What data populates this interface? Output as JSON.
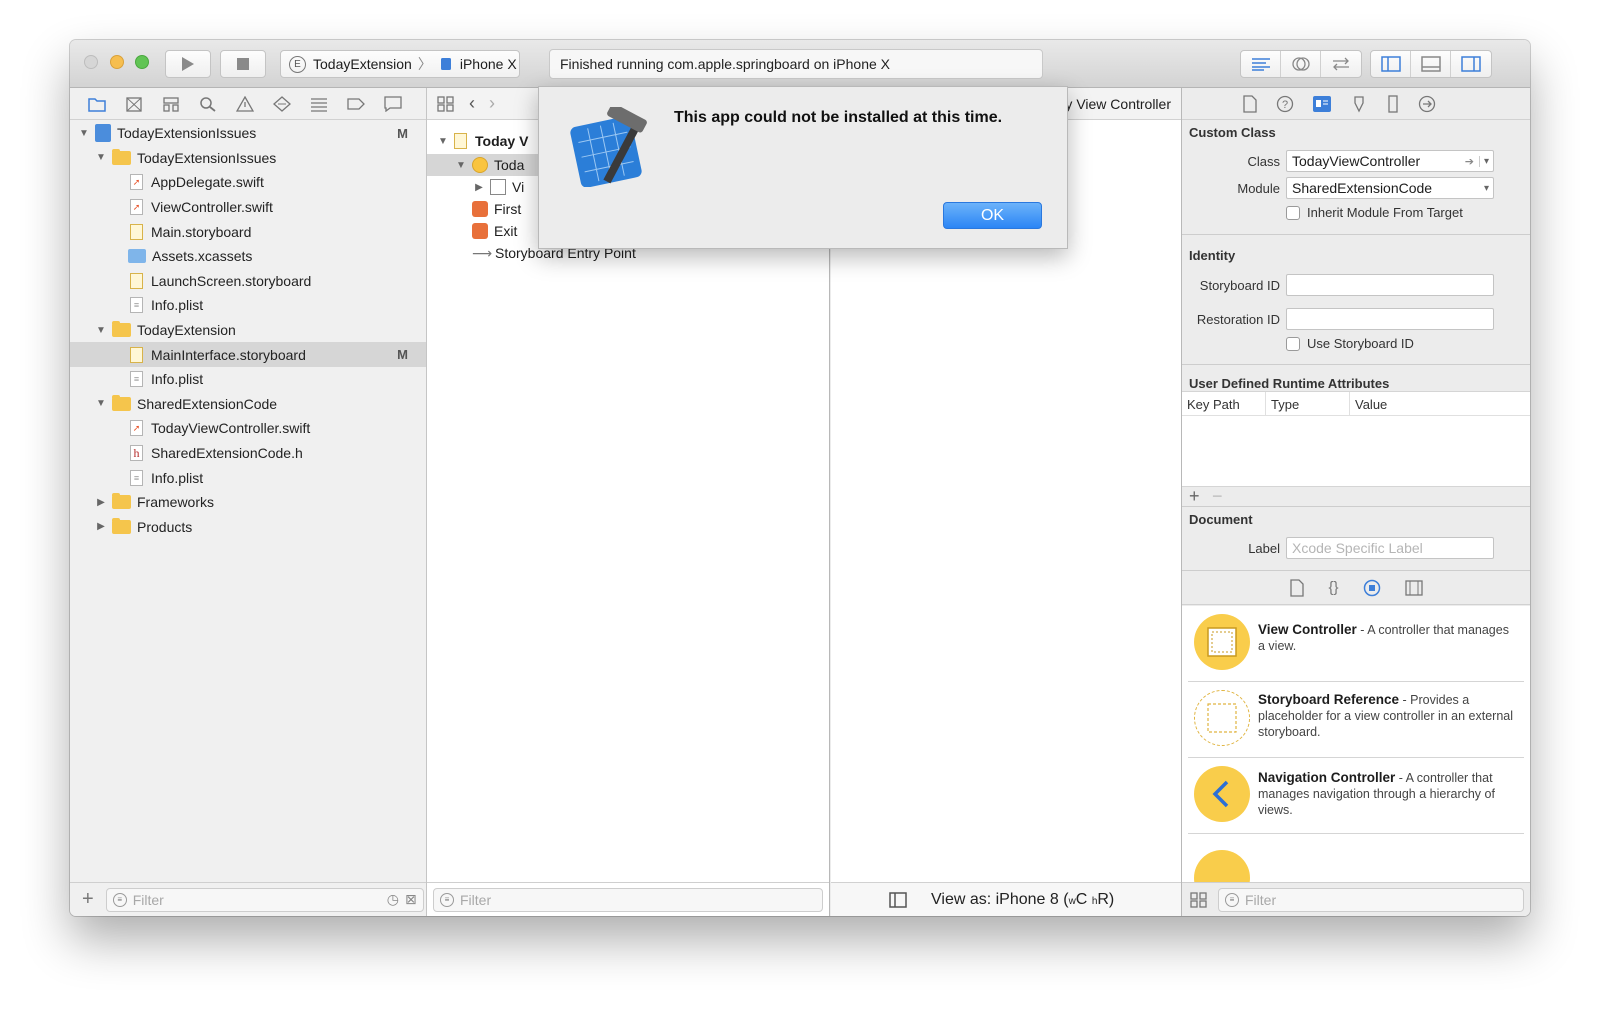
{
  "toolbar": {
    "scheme": "TodayExtension",
    "scheme_badge": "E",
    "device": "iPhone X",
    "activity": "Finished running com.apple.springboard on iPhone X"
  },
  "navigator": {
    "tree": [
      {
        "label": "TodayExtensionIssues",
        "kind": "project",
        "badge": "M"
      },
      {
        "label": "TodayExtensionIssues",
        "kind": "folder"
      },
      {
        "label": "AppDelegate.swift",
        "kind": "swift"
      },
      {
        "label": "ViewController.swift",
        "kind": "swift"
      },
      {
        "label": "Main.storyboard",
        "kind": "storyboard"
      },
      {
        "label": "Assets.xcassets",
        "kind": "xcassets"
      },
      {
        "label": "LaunchScreen.storyboard",
        "kind": "storyboard"
      },
      {
        "label": "Info.plist",
        "kind": "plist"
      },
      {
        "label": "TodayExtension",
        "kind": "folder"
      },
      {
        "label": "MainInterface.storyboard",
        "kind": "storyboard",
        "badge": "M"
      },
      {
        "label": "Info.plist",
        "kind": "plist"
      },
      {
        "label": "SharedExtensionCode",
        "kind": "folder"
      },
      {
        "label": "TodayViewController.swift",
        "kind": "swift"
      },
      {
        "label": "SharedExtensionCode.h",
        "kind": "h"
      },
      {
        "label": "Info.plist",
        "kind": "plist"
      },
      {
        "label": "Frameworks",
        "kind": "folder"
      },
      {
        "label": "Products",
        "kind": "folder"
      }
    ],
    "filter_placeholder": "Filter"
  },
  "outline": {
    "rows": [
      {
        "label": "Today V"
      },
      {
        "label": "Toda"
      },
      {
        "label": "Vi"
      },
      {
        "label": "First"
      },
      {
        "label": "Exit"
      },
      {
        "label": "Storyboard Entry Point"
      }
    ],
    "filter_placeholder": "Filter"
  },
  "canvas": {
    "breadcrumb_tail": "day View Controller",
    "view_as": "View as: iPhone 8 (",
    "size_class_w": "w",
    "size_class_c": "C",
    "size_class_h": "h",
    "size_class_r": "R)"
  },
  "inspector": {
    "custom_class_title": "Custom Class",
    "class_label": "Class",
    "class_value": "TodayViewController",
    "module_label": "Module",
    "module_value": "SharedExtensionCode",
    "inherit_label": "Inherit Module From Target",
    "identity_title": "Identity",
    "storyboard_id_label": "Storyboard ID",
    "restoration_id_label": "Restoration ID",
    "use_storyboard_id_label": "Use Storyboard ID",
    "udra_title": "User Defined Runtime Attributes",
    "udra_columns": [
      "Key Path",
      "Type",
      "Value"
    ],
    "document_title": "Document",
    "doc_label_label": "Label",
    "doc_label_placeholder": "Xcode Specific Label",
    "filter_placeholder": "Filter",
    "library": [
      {
        "name": "View Controller",
        "desc": " - A controller that manages a view."
      },
      {
        "name": "Storyboard Reference",
        "desc": " - Provides a placeholder for a view controller in an external storyboard."
      },
      {
        "name": "Navigation Controller",
        "desc": " - A controller that manages navigation through a hierarchy of views."
      }
    ]
  },
  "alert": {
    "message": "This app could not be installed at this time.",
    "ok_label": "OK"
  },
  "colors": {
    "accent": "#2b85f5",
    "library_icon": "#f9cd4b",
    "folder": "#f5c54c"
  }
}
